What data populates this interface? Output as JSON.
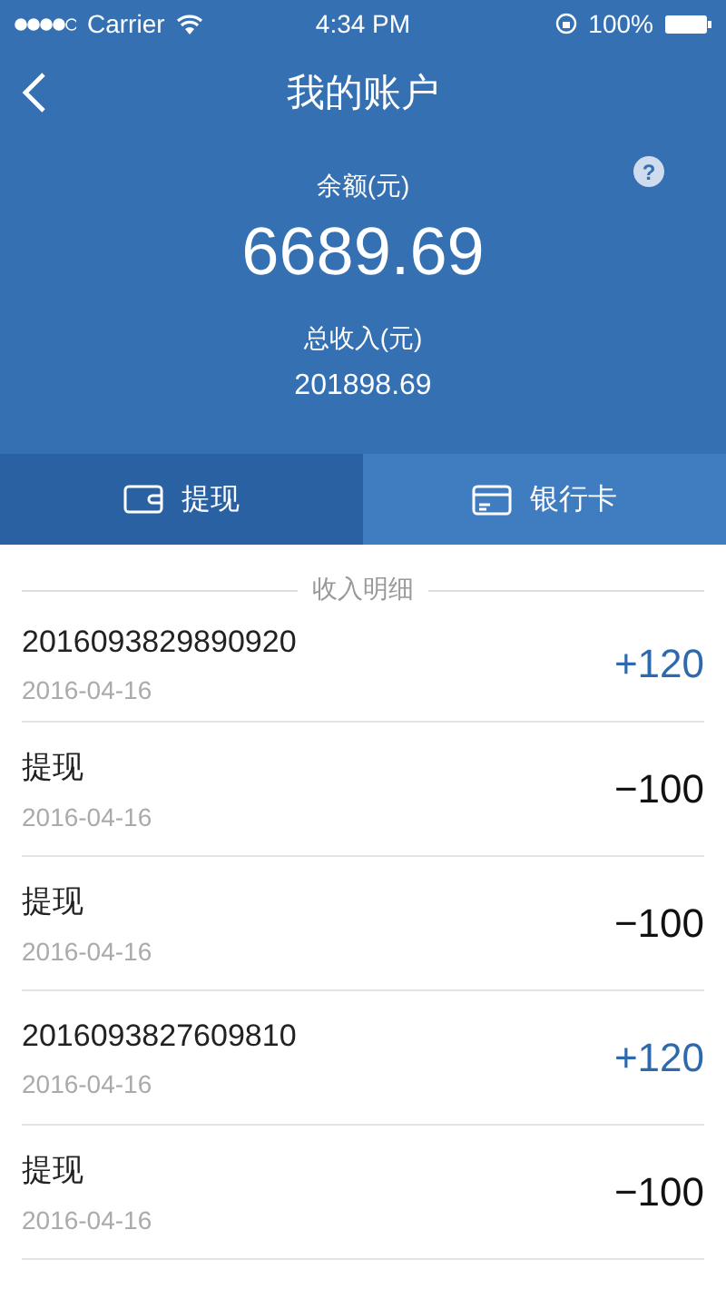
{
  "status_bar": {
    "carrier": "Carrier",
    "time": "4:34 PM",
    "battery": "100%"
  },
  "nav": {
    "title": "我的账户"
  },
  "summary": {
    "help": "?",
    "balance_label": "余额(元)",
    "balance": "6689.69",
    "total_label": "总收入(元)",
    "total": "201898.69"
  },
  "tabs": [
    {
      "label": "提现",
      "kind": "wallet",
      "selected": true
    },
    {
      "label": "银行卡",
      "kind": "card",
      "selected": false
    }
  ],
  "list": {
    "heading": "收入明细",
    "rows": [
      {
        "title": "2016093829890920",
        "date": "2016-04-16",
        "amount": "+120",
        "kind": "income"
      },
      {
        "title": "提现",
        "date": "2016-04-16",
        "amount": "−100",
        "kind": "withdraw"
      },
      {
        "title": "提现",
        "date": "2016-04-16",
        "amount": "−100",
        "kind": "withdraw"
      },
      {
        "title": "2016093827609810",
        "date": "2016-04-16",
        "amount": "+120",
        "kind": "income"
      },
      {
        "title": "提现",
        "date": "2016-04-16",
        "amount": "−100",
        "kind": "withdraw"
      }
    ]
  }
}
